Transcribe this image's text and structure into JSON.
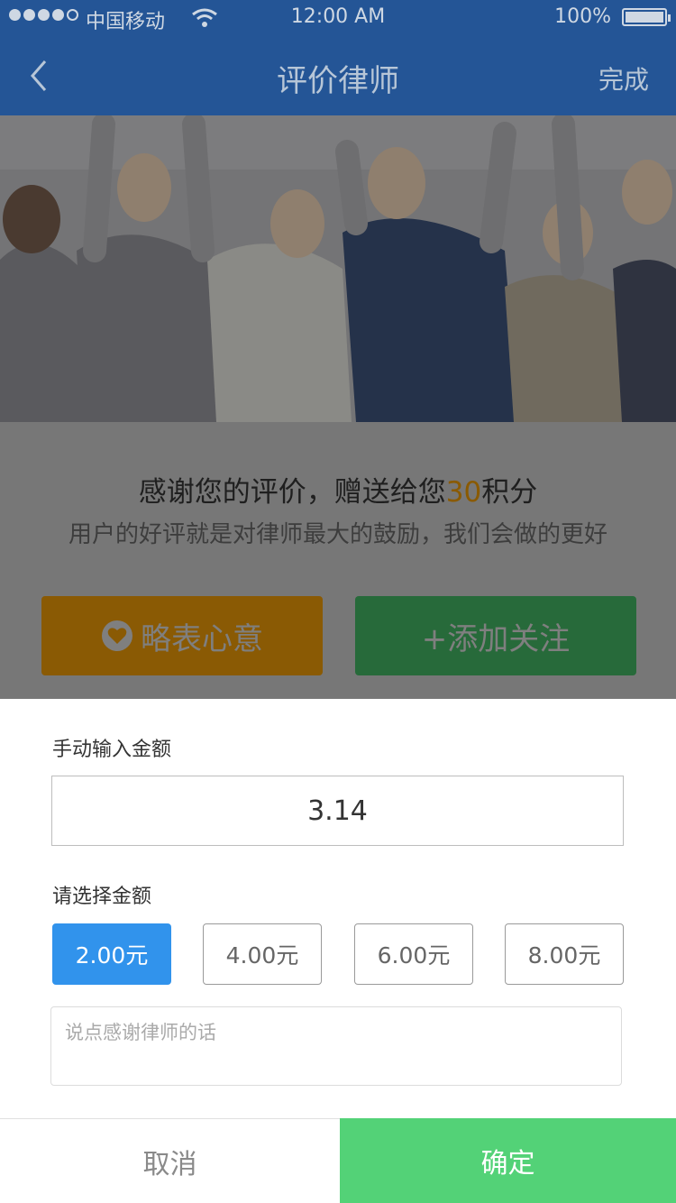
{
  "status_bar": {
    "carrier": "中国移动",
    "time": "12:00 AM",
    "battery": "100%"
  },
  "nav": {
    "title": "评价律师",
    "done_label": "完成"
  },
  "thanks": {
    "prefix": "感谢您的评价，赠送给您",
    "points": "30",
    "suffix": "积分",
    "encourage": "用户的好评就是对律师最大的鼓励，我们会做的更好"
  },
  "actions": {
    "reward_label": "略表心意",
    "follow_label": "+添加关注"
  },
  "tip_sheet": {
    "manual_label": "手动输入金额",
    "manual_value": "3.14",
    "choose_label": "请选择金额",
    "options": [
      "2.00元",
      "4.00元",
      "6.00元",
      "8.00元"
    ],
    "selected_index": 0,
    "message_placeholder": "说点感谢律师的话",
    "cancel_label": "取消",
    "confirm_label": "确定"
  },
  "colors": {
    "nav_bg": "#245596",
    "selected_option": "#3193ec",
    "confirm": "#53d277",
    "points_accent": "#8a5a00"
  }
}
